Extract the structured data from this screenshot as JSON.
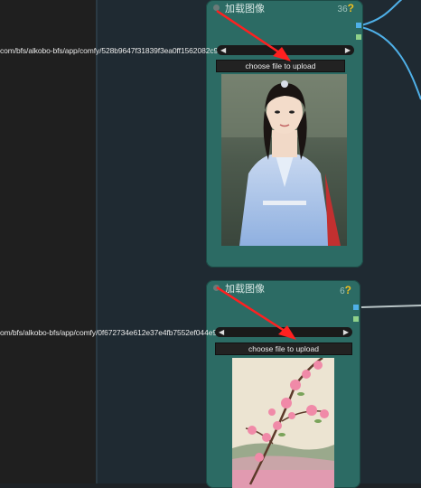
{
  "nodes": [
    {
      "title": "加载图像",
      "badge_num": "36",
      "badge_q": "?",
      "path": "com/bfs/alkobo-bfs/app/comfy/528b9647f31839f3ea0ff1562082c938d5728aaf.jpg@1536w_1536h_0e",
      "upload_label": "choose file to upload"
    },
    {
      "title": "加载图像",
      "badge_num": "6",
      "badge_q": "?",
      "path": "om/bfs/alkobo-bfs/app/comfy/0f672734e612e37e4fb7552ef044e910b8472cd.jpg@1536w_1536h_0e",
      "upload_label": "choose file to upload"
    }
  ],
  "colors": {
    "node_bg": "#2c6b64",
    "link_blue": "#4fb0e8",
    "link_gray": "#b8c4c6",
    "annotation_red": "#ff2020"
  }
}
